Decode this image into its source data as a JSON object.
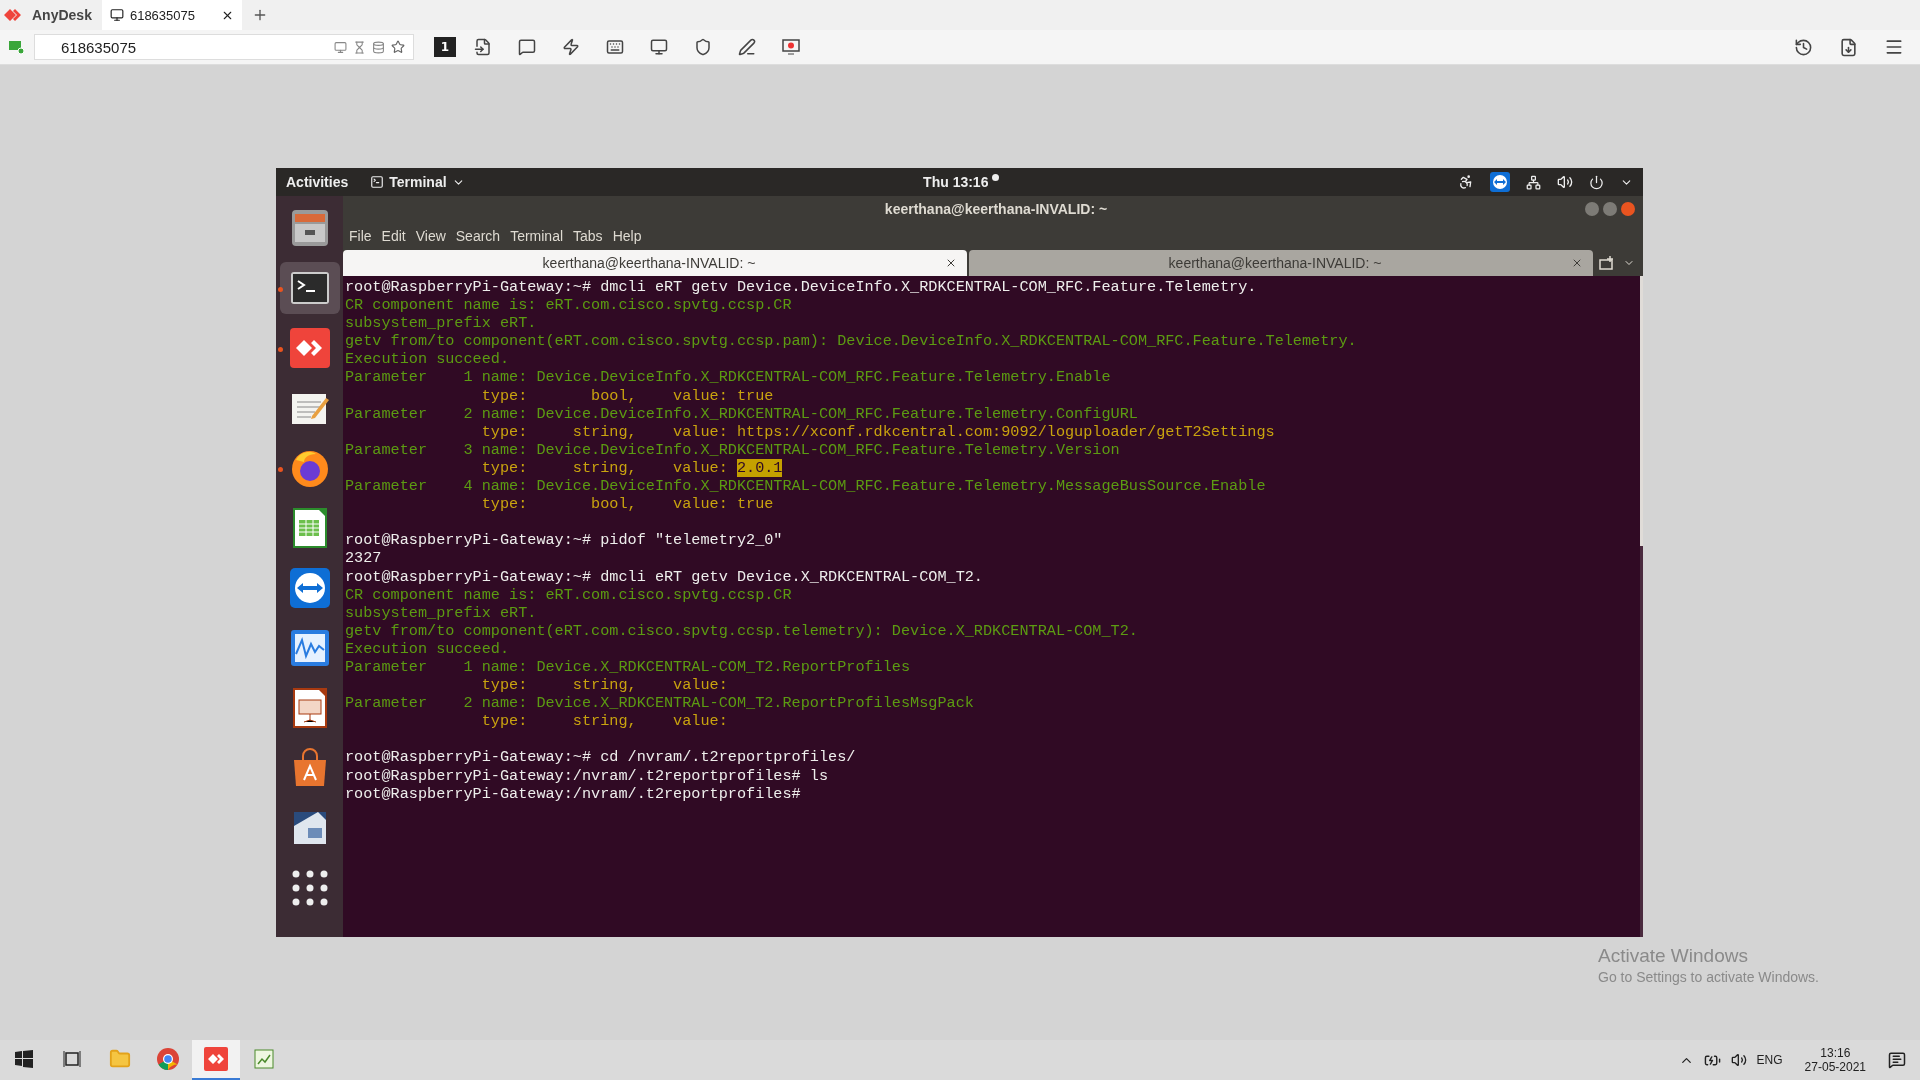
{
  "anydesk": {
    "app_name": "AnyDesk",
    "tab": {
      "label": "618635075",
      "selected": true
    },
    "address": "618635075",
    "display_number": "1"
  },
  "remote": {
    "top_bar": {
      "activities": "Activities",
      "app_menu": "Terminal",
      "clock": "Thu 13:16"
    },
    "dock": [
      {
        "kind": "files",
        "selected": false,
        "running": false
      },
      {
        "kind": "terminal",
        "selected": true,
        "running": true
      },
      {
        "kind": "anydesk",
        "selected": false,
        "running": true
      },
      {
        "kind": "editor",
        "selected": false,
        "running": false
      },
      {
        "kind": "firefox",
        "selected": false,
        "running": true
      },
      {
        "kind": "spreadsheet",
        "selected": false,
        "running": false
      },
      {
        "kind": "teamviewer",
        "selected": false,
        "running": false
      },
      {
        "kind": "monitor",
        "selected": false,
        "running": false
      },
      {
        "kind": "presentation",
        "selected": false,
        "running": false
      },
      {
        "kind": "store",
        "selected": false,
        "running": false
      },
      {
        "kind": "document",
        "selected": false,
        "running": false
      },
      {
        "kind": "apps",
        "selected": false,
        "running": false
      }
    ],
    "window": {
      "title": "keerthana@keerthana-INVALID: ~",
      "menu": [
        "File",
        "Edit",
        "View",
        "Search",
        "Terminal",
        "Tabs",
        "Help"
      ],
      "tabs": [
        {
          "label": "keerthana@keerthana-INVALID: ~",
          "selected": true
        },
        {
          "label": "keerthana@keerthana-INVALID: ~",
          "selected": false
        }
      ],
      "terminal_lines": [
        {
          "kind": "prompt",
          "text": "root@RaspberryPi-Gateway:~# dmcli eRT getv Device.DeviceInfo.X_RDKCENTRAL-COM_RFC.Feature.Telemetry."
        },
        {
          "kind": "info",
          "text": "CR component name is: eRT.com.cisco.spvtg.ccsp.CR"
        },
        {
          "kind": "info",
          "text": "subsystem_prefix eRT."
        },
        {
          "kind": "info",
          "text": "getv from/to component(eRT.com.cisco.spvtg.ccsp.pam): Device.DeviceInfo.X_RDKCENTRAL-COM_RFC.Feature.Telemetry."
        },
        {
          "kind": "info",
          "text": "Execution succeed."
        },
        {
          "kind": "info",
          "text": "Parameter    1 name: Device.DeviceInfo.X_RDKCENTRAL-COM_RFC.Feature.Telemetry.Enable"
        },
        {
          "kind": "type",
          "text": "               type:       bool,    value: true"
        },
        {
          "kind": "info",
          "text": "Parameter    2 name: Device.DeviceInfo.X_RDKCENTRAL-COM_RFC.Feature.Telemetry.ConfigURL"
        },
        {
          "kind": "type",
          "text": "               type:     string,    value: https://xconf.rdkcentral.com:9092/loguploader/getT2Settings"
        },
        {
          "kind": "info",
          "text": "Parameter    3 name: Device.DeviceInfo.X_RDKCENTRAL-COM_RFC.Feature.Telemetry.Version"
        },
        {
          "kind": "type",
          "text": "               type:     string,    value: ",
          "highlight": "2.0.1"
        },
        {
          "kind": "info",
          "text": "Parameter    4 name: Device.DeviceInfo.X_RDKCENTRAL-COM_RFC.Feature.Telemetry.MessageBusSource.Enable"
        },
        {
          "kind": "type",
          "text": "               type:       bool,    value: true"
        },
        {
          "kind": "blank"
        },
        {
          "kind": "prompt",
          "text": "root@RaspberryPi-Gateway:~# pidof \"telemetry2_0\""
        },
        {
          "kind": "prompt",
          "text": "2327"
        },
        {
          "kind": "prompt",
          "text": "root@RaspberryPi-Gateway:~# dmcli eRT getv Device.X_RDKCENTRAL-COM_T2."
        },
        {
          "kind": "info",
          "text": "CR component name is: eRT.com.cisco.spvtg.ccsp.CR"
        },
        {
          "kind": "info",
          "text": "subsystem_prefix eRT."
        },
        {
          "kind": "info",
          "text": "getv from/to component(eRT.com.cisco.spvtg.ccsp.telemetry): Device.X_RDKCENTRAL-COM_T2."
        },
        {
          "kind": "info",
          "text": "Execution succeed."
        },
        {
          "kind": "info",
          "text": "Parameter    1 name: Device.X_RDKCENTRAL-COM_T2.ReportProfiles"
        },
        {
          "kind": "type",
          "text": "               type:     string,    value:"
        },
        {
          "kind": "info",
          "text": "Parameter    2 name: Device.X_RDKCENTRAL-COM_T2.ReportProfilesMsgPack"
        },
        {
          "kind": "type",
          "text": "               type:     string,    value:"
        },
        {
          "kind": "blank"
        },
        {
          "kind": "prompt",
          "text": "root@RaspberryPi-Gateway:~# cd /nvram/.t2reportprofiles/"
        },
        {
          "kind": "prompt",
          "text": "root@RaspberryPi-Gateway:/nvram/.t2reportprofiles# ls"
        },
        {
          "kind": "prompt",
          "text": "root@RaspberryPi-Gateway:/nvram/.t2reportprofiles#"
        }
      ]
    }
  },
  "activation_notice": {
    "title": "Activate Windows",
    "message": "Go to Settings to activate Windows."
  },
  "taskbar": {
    "apps": [
      {
        "kind": "taskview",
        "selected": false
      },
      {
        "kind": "explorer",
        "selected": false
      },
      {
        "kind": "chrome",
        "selected": false
      },
      {
        "kind": "anydesk",
        "selected": true
      },
      {
        "kind": "notepad",
        "selected": false
      }
    ],
    "language": "ENG",
    "time": "13:16",
    "date": "27-05-2021"
  }
}
